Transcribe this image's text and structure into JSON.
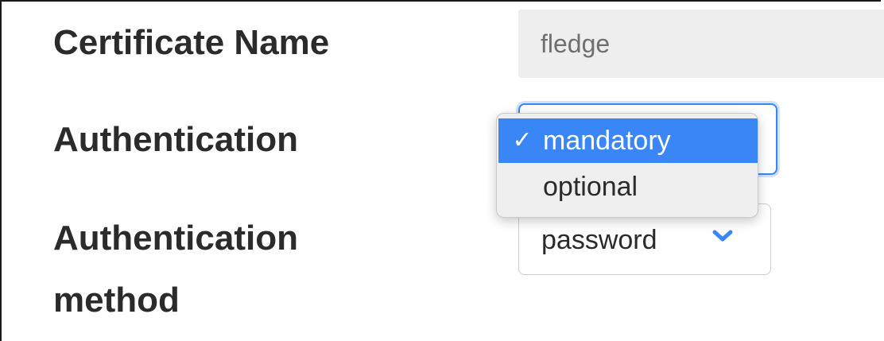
{
  "form": {
    "certificate_name": {
      "label": "Certificate Name",
      "value": "fledge"
    },
    "authentication": {
      "label": "Authentication",
      "options": [
        {
          "label": "mandatory",
          "selected": true
        },
        {
          "label": "optional",
          "selected": false
        }
      ],
      "check_glyph": "✓"
    },
    "authentication_method": {
      "label_line1": "Authentication",
      "label_line2": "method",
      "value": "password",
      "icon": "chevron-down-icon"
    }
  },
  "colors": {
    "accent": "#3a86f7",
    "label_text": "#2b2b2b",
    "input_bg": "#eeeeee",
    "placeholder_text": "#6f6f6f"
  }
}
